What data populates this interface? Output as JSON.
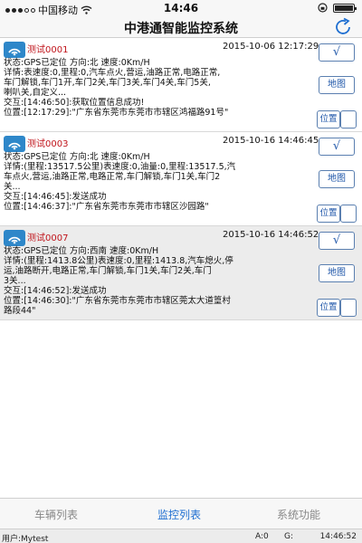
{
  "status_bar": {
    "carrier": "中国移动",
    "time": "14:46",
    "battery_level": 1.0
  },
  "nav": {
    "title": "中港通智能监控系统"
  },
  "vehicles": [
    {
      "name": "测试0001",
      "time": "2015-10-06 12:17:29",
      "lines": [
        "状态:GPS已定位 方向:北 速度:0Km/H",
        "详情:表速度:0,里程:0,汽车点火,营运,油路正常,电路正常,",
        "车门解锁,车门1开,车门2关,车门3关,车门4关,车门5关,",
        "喇叭关,自定义...",
        "交互:[14:46:50]:获取位置信息成功!",
        "位置:[12:17:29]:\"广东省东莞市东莞市市辖区鸿福路91号\""
      ],
      "check_label": "√",
      "map_label": "地图",
      "pos_label": "位置"
    },
    {
      "name": "测试0003",
      "time": "2015-10-16 14:46:45",
      "lines": [
        "状态:GPS已定位 方向:北 速度:0Km/H",
        "详情:(里程:13517.5公里)表速度:0,油量:0,里程:13517.5,汽",
        "车点火,营运,油路正常,电路正常,车门解锁,车门1关,车门2",
        "关...",
        "交互:[14:46:45]:发送成功",
        "位置:[14:46:37]:\"广东省东莞市东莞市市辖区沙园路\""
      ],
      "check_label": "√",
      "map_label": "地图",
      "pos_label": "位置"
    },
    {
      "name": "测试0007",
      "time": "2015-10-16 14:46:52",
      "lines": [
        "状态:GPS已定位 方向:西南 速度:0Km/H",
        "详情:(里程:1413.8公里)表速度:0,里程:1413.8,汽车熄火,停",
        "运,油路断开,电路正常,车门解锁,车门1关,车门2关,车门",
        "3关...",
        "交互:[14:46:52]:发送成功",
        "位置:[14:46:30]:\"广东省东莞市东莞市市辖区莞太大道篁村",
        "路段44\""
      ],
      "check_label": "√",
      "map_label": "地图",
      "pos_label": "位置"
    }
  ],
  "tabs": [
    {
      "label": "车辆列表"
    },
    {
      "label": "监控列表"
    },
    {
      "label": "系统功能"
    }
  ],
  "bottom": {
    "user": "用户:Mytest",
    "a": "A:0",
    "g": "G:",
    "time": "14:46:52"
  },
  "colors": {
    "accent": "#1f6fd1",
    "vehicle_name": "#c0141b",
    "selected_row": "#ececec"
  }
}
